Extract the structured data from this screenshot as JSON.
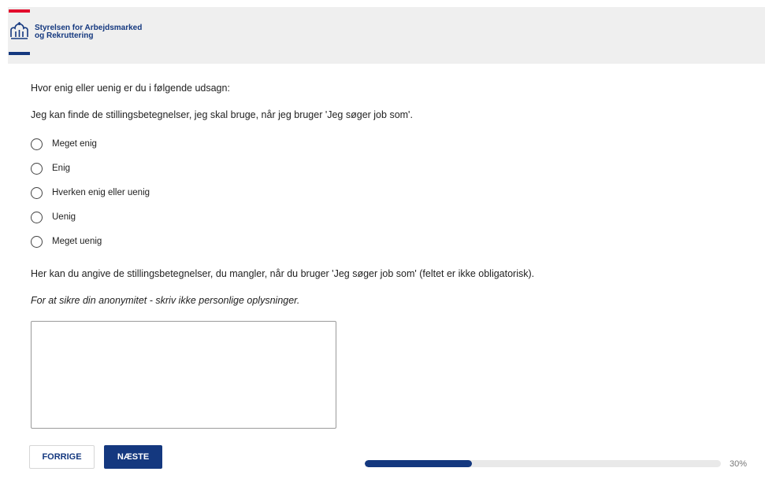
{
  "header": {
    "logo_line1": "Styrelsen for Arbejdsmarked",
    "logo_line2": "og Rekruttering",
    "icon": "crown-logo-icon",
    "colors": {
      "red": "#e30c2c",
      "blue": "#14387f",
      "background": "#efefef"
    }
  },
  "survey": {
    "intro": "Hvor enig eller uenig er du i følgende udsagn:",
    "statement": "Jeg kan finde de stillingsbetegnelser, jeg skal bruge, når jeg bruger 'Jeg søger job som'.",
    "options": [
      {
        "label": "Meget enig",
        "selected": false
      },
      {
        "label": "Enig",
        "selected": false
      },
      {
        "label": "Hverken enig eller uenig",
        "selected": false
      },
      {
        "label": "Uenig",
        "selected": false
      },
      {
        "label": "Meget uenig",
        "selected": false
      }
    ],
    "free_text_question": "Her kan du angive de stillingsbetegnelser, du mangler, når du bruger 'Jeg søger job som' (feltet er ikke obligatorisk).",
    "anonymity_note": "For at sikre din anonymitet - skriv ikke personlige oplysninger.",
    "free_text_value": ""
  },
  "navigation": {
    "prev_label": "FORRIGE",
    "next_label": "NÆSTE"
  },
  "progress": {
    "percent": 30,
    "label": "30%"
  }
}
